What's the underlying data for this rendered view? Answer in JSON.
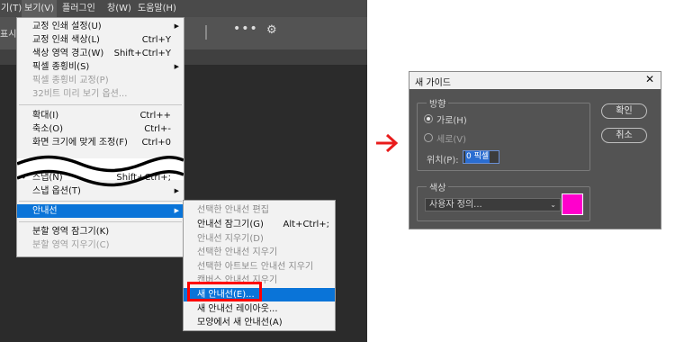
{
  "menubar": {
    "items": [
      "기(T)",
      "보기(V)",
      "플러그인",
      "창(W)",
      "도움말(H)"
    ]
  },
  "options_bar": {
    "left_label": "표시",
    "more_label": "•••",
    "gear_icon": "gear-icon"
  },
  "view_menu": {
    "items": [
      {
        "label": "교정 인쇄 설정(U)",
        "shortcut": ""
      },
      {
        "label": "교정 인쇄 색상(L)",
        "shortcut": "Ctrl+Y"
      },
      {
        "label": "색상 영역 경고(W)",
        "shortcut": "Shift+Ctrl+Y"
      },
      {
        "label": "픽셀 종횡비(S)",
        "shortcut": ""
      },
      {
        "label": "픽셀 종횡비 교정(P)",
        "shortcut": ""
      },
      {
        "label": "32비트 미리 보기 옵션...",
        "shortcut": ""
      },
      {
        "label": "확대(I)",
        "shortcut": "Ctrl++"
      },
      {
        "label": "축소(O)",
        "shortcut": "Ctrl+-"
      },
      {
        "label": "화면 크기에 맞게 조정(F)",
        "shortcut": "Ctrl+0"
      },
      {
        "label": "스냅(N)",
        "shortcut": "Shift+Ctrl+;"
      },
      {
        "label": "스냅 옵션(T)",
        "shortcut": ""
      },
      {
        "label": "안내선",
        "shortcut": ""
      },
      {
        "label": "분할 영역 잠그기(K)",
        "shortcut": ""
      },
      {
        "label": "분할 영역 지우기(C)",
        "shortcut": ""
      }
    ]
  },
  "guides_submenu": {
    "items": [
      {
        "label": "선택한 안내선 편집",
        "shortcut": ""
      },
      {
        "label": "안내선 잠그기(G)",
        "shortcut": "Alt+Ctrl+;"
      },
      {
        "label": "안내선 지우기(D)",
        "shortcut": ""
      },
      {
        "label": "선택한 안내선 지우기",
        "shortcut": ""
      },
      {
        "label": "선택한 아트보드 안내선 지우기",
        "shortcut": ""
      },
      {
        "label": "캔버스 안내선 지우기",
        "shortcut": ""
      },
      {
        "label": "새 안내선(E)...",
        "shortcut": ""
      },
      {
        "label": "새 안내선 레이아웃...",
        "shortcut": ""
      },
      {
        "label": "모양에서 새 안내선(A)",
        "shortcut": ""
      }
    ]
  },
  "new_guide_dialog": {
    "title": "새 가이드",
    "orientation_label": "방향",
    "horizontal_label": "가로(H)",
    "vertical_label": "세로(V)",
    "horizontal_selected": true,
    "position_label": "위치(P):",
    "position_value": "0 픽셀",
    "color_label": "색상",
    "color_select_value": "사용자 정의...",
    "color_swatch": "#ff00cc",
    "ok_label": "확인",
    "cancel_label": "취소"
  },
  "colors": {
    "highlight": "#0a74d8",
    "callout_box": "#ff0000",
    "arrow": "#e81c1c"
  }
}
